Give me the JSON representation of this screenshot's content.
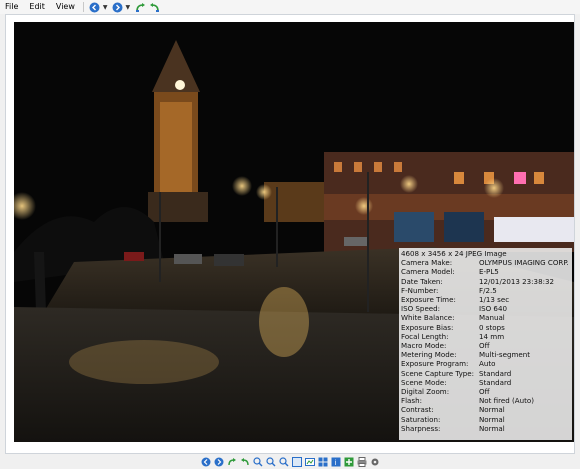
{
  "menu": {
    "file": "File",
    "edit": "Edit",
    "view": "View"
  },
  "colors": {
    "accent": "#2a6fc9",
    "green": "#2f9a3a",
    "frame_border": "#cfd4da"
  },
  "toolbar_icons": [
    "back-circle-icon",
    "forward-circle-icon",
    "rotate-left-icon",
    "rotate-right-icon"
  ],
  "bottom_icons": [
    "prev-icon",
    "next-icon",
    "rotate-left-icon",
    "rotate-right-icon",
    "zoom-in-icon",
    "zoom-out-icon",
    "zoom-fit-icon",
    "actual-size-icon",
    "slideshow-icon",
    "thumbnails-icon",
    "info-icon",
    "fullscreen-icon",
    "print-icon",
    "settings-icon"
  ],
  "photo_info": {
    "header": "4608 x 3456 x 24 JPEG Image",
    "rows": [
      {
        "key": "Camera Make:",
        "value": "OLYMPUS IMAGING CORP."
      },
      {
        "key": "Camera Model:",
        "value": "E-PL5"
      },
      {
        "key": "Date Taken:",
        "value": "12/01/2013 23:38:32"
      },
      {
        "key": "F-Number:",
        "value": "F/2.5"
      },
      {
        "key": "Exposure Time:",
        "value": "1/13 sec"
      },
      {
        "key": "ISO Speed:",
        "value": "ISO 640"
      },
      {
        "key": "White Balance:",
        "value": "Manual"
      },
      {
        "key": "Exposure Bias:",
        "value": "0 stops"
      },
      {
        "key": "Focal Length:",
        "value": "14 mm"
      },
      {
        "key": "Macro Mode:",
        "value": "Off"
      },
      {
        "key": "Metering Mode:",
        "value": "Multi-segment"
      },
      {
        "key": "Exposure Program:",
        "value": "Auto"
      },
      {
        "key": "Scene Capture Type:",
        "value": "Standard"
      },
      {
        "key": "Scene Mode:",
        "value": "Standard"
      },
      {
        "key": "Digital Zoom:",
        "value": "Off"
      },
      {
        "key": "Flash:",
        "value": "Not fired (Auto)"
      },
      {
        "key": "Contrast:",
        "value": "Normal"
      },
      {
        "key": "Saturation:",
        "value": "Normal"
      },
      {
        "key": "Sharpness:",
        "value": "Normal"
      }
    ]
  }
}
